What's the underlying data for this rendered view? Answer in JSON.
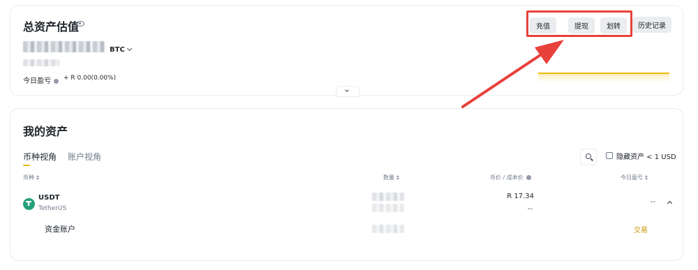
{
  "overview": {
    "title": "总资产估值",
    "unit_select": "BTC",
    "pnl_label": "今日盈亏",
    "pnl_value": "+ R 0.00(0.00%)",
    "buttons": {
      "deposit": "充值",
      "withdraw": "提现",
      "transfer": "划转",
      "history": "历史记录"
    }
  },
  "assets": {
    "title": "我的资产",
    "tabs": [
      "币种视角",
      "账户视角"
    ],
    "hide_small_label": "隐藏资产 < 1 USD",
    "columns": {
      "coin": "币种",
      "amount": "数量",
      "price": "币价 / 成本价",
      "today_pnl": "今日盈亏"
    },
    "rows": [
      {
        "symbol": "USDT",
        "name": "TetherUS",
        "price": "R 17.34",
        "cost": "--",
        "today_pnl": "--",
        "sub_account": "资金账户",
        "action": "交易"
      }
    ]
  },
  "colors": {
    "highlight": "#e8413b",
    "accent": "#f0b90b",
    "trade_link": "#c99400",
    "coin_icon": "#26a17b"
  },
  "icons": [
    "eye-icon",
    "chevron-down-icon",
    "info-icon",
    "search-icon",
    "sort-icon",
    "usdt-coin-icon",
    "chevron-up-icon",
    "annotation-arrow"
  ]
}
